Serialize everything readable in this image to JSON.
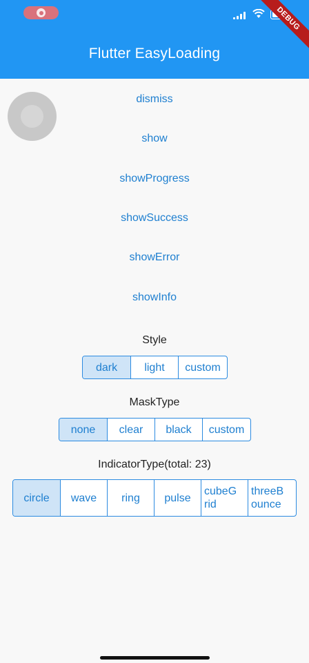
{
  "app": {
    "title": "Flutter EasyLoading",
    "debug_badge": "DEBUG"
  },
  "actions": [
    "dismiss",
    "show",
    "showProgress",
    "showSuccess",
    "showError",
    "showInfo"
  ],
  "style": {
    "label": "Style",
    "options": [
      "dark",
      "light",
      "custom"
    ],
    "selected": "dark"
  },
  "mask_type": {
    "label": "MaskType",
    "options": [
      "none",
      "clear",
      "black",
      "custom"
    ],
    "selected": "none"
  },
  "indicator_type": {
    "label": "IndicatorType(total: 23)",
    "options": [
      "circle",
      "wave",
      "ring",
      "pulse",
      "cubeGrid",
      "threeBounce"
    ],
    "display": [
      "circle",
      "wave",
      "ring",
      "pulse",
      "cubeG\nrid",
      "threeB\nounce"
    ],
    "selected": "circle"
  },
  "colors": {
    "appbar": "#2196f3",
    "accent": "#1e7fd0",
    "selected_bg": "#cfe4f7"
  }
}
